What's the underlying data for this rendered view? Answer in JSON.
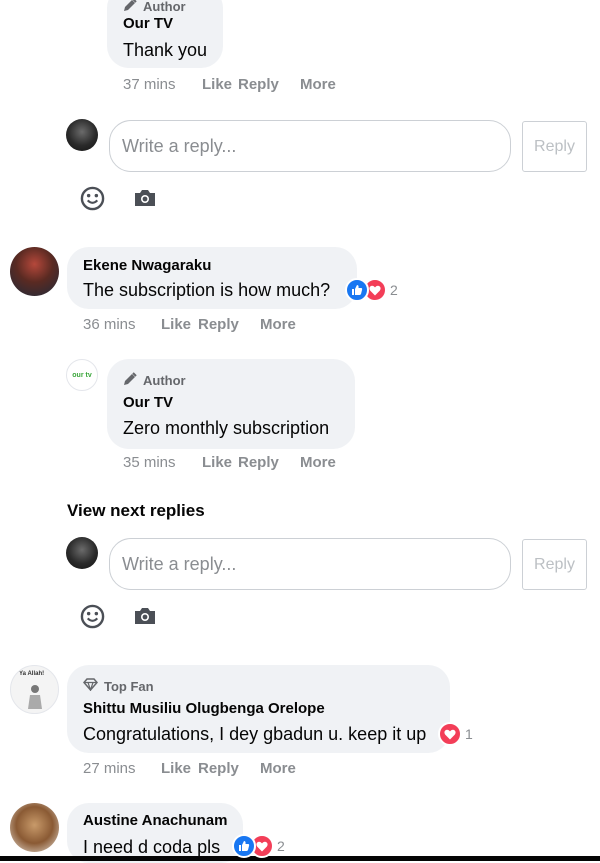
{
  "comment1": {
    "badge": "Author",
    "name": "Our TV",
    "text": "Thank you",
    "time": "37 mins",
    "like": "Like",
    "reply": "Reply",
    "more": "More"
  },
  "reply_box_1": {
    "placeholder": "Write a reply...",
    "button": "Reply"
  },
  "comment2": {
    "name": "Ekene Nwagaraku",
    "text": "The subscription is how much?",
    "reaction_count": "2",
    "time": "36 mins",
    "like": "Like",
    "reply": "Reply",
    "more": "More"
  },
  "comment3": {
    "badge": "Author",
    "name": "Our TV",
    "text": "Zero monthly subscription",
    "time": "35 mins",
    "like": "Like",
    "reply": "Reply",
    "more": "More",
    "avatar_logo": "our tv"
  },
  "view_next": "View next replies",
  "reply_box_2": {
    "placeholder": "Write a reply...",
    "button": "Reply"
  },
  "comment4": {
    "badge": "Top Fan",
    "name": "Shittu Musiliu Olugbenga Orelope",
    "text": "Congratulations, I dey gbadun u. keep it up",
    "reaction_count": "1",
    "time": "27 mins",
    "like": "Like",
    "reply": "Reply",
    "more": "More",
    "avatar_caption": "Ya Allah!"
  },
  "comment5": {
    "name": "Austine Anachunam",
    "text": "I need d coda pls",
    "reaction_count": "2"
  },
  "colors": {
    "like_blue": "#1877f2",
    "love_red": "#f33e58",
    "bubble": "#f0f2f5",
    "meta": "#8a8d91"
  }
}
